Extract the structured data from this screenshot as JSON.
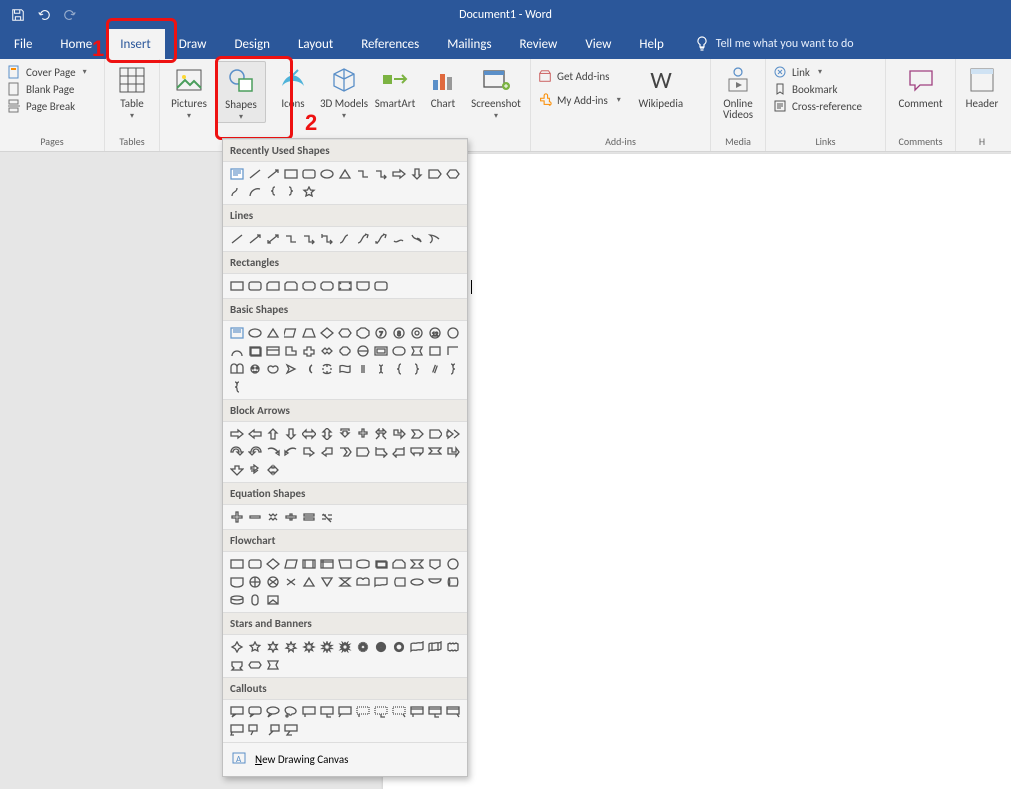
{
  "app": {
    "title": "Document1  -  Word"
  },
  "tabs": {
    "file": "File",
    "home": "Home",
    "insert": "Insert",
    "draw": "Draw",
    "design": "Design",
    "layout": "Layout",
    "references": "References",
    "mailings": "Mailings",
    "review": "Review",
    "view": "View",
    "help": "Help",
    "tell_me": "Tell me what you want to do"
  },
  "pages_group": {
    "label": "Pages",
    "cover_page": "Cover Page",
    "blank_page": "Blank Page",
    "page_break": "Page Break"
  },
  "tables_group": {
    "label": "Tables",
    "table": "Table"
  },
  "illustrations": {
    "pictures": "Pictures",
    "shapes": "Shapes",
    "icons": "Icons",
    "models_3d": "3D Models",
    "smartart": "SmartArt",
    "chart": "Chart",
    "screenshot": "Screenshot"
  },
  "addins_group": {
    "label": "Add-ins",
    "get": "Get Add-ins",
    "my": "My Add-ins",
    "wikipedia": "Wikipedia"
  },
  "media_group": {
    "label": "Media",
    "online_videos": "Online Videos"
  },
  "links_group": {
    "label": "Links",
    "link": "Link",
    "bookmark": "Bookmark",
    "crossref": "Cross-reference"
  },
  "comments_group": {
    "label": "Comments",
    "comment": "Comment"
  },
  "header_group": {
    "header": "Header"
  },
  "annotations": {
    "one": "1",
    "two": "2"
  },
  "shapes_dd": {
    "recently_used": "Recently Used Shapes",
    "lines": "Lines",
    "rectangles": "Rectangles",
    "basic": "Basic Shapes",
    "block_arrows": "Block Arrows",
    "equation": "Equation Shapes",
    "flowchart": "Flowchart",
    "stars": "Stars and Banners",
    "callouts": "Callouts",
    "new_canvas_prefix": "N",
    "new_canvas_rest": "ew Drawing Canvas"
  }
}
